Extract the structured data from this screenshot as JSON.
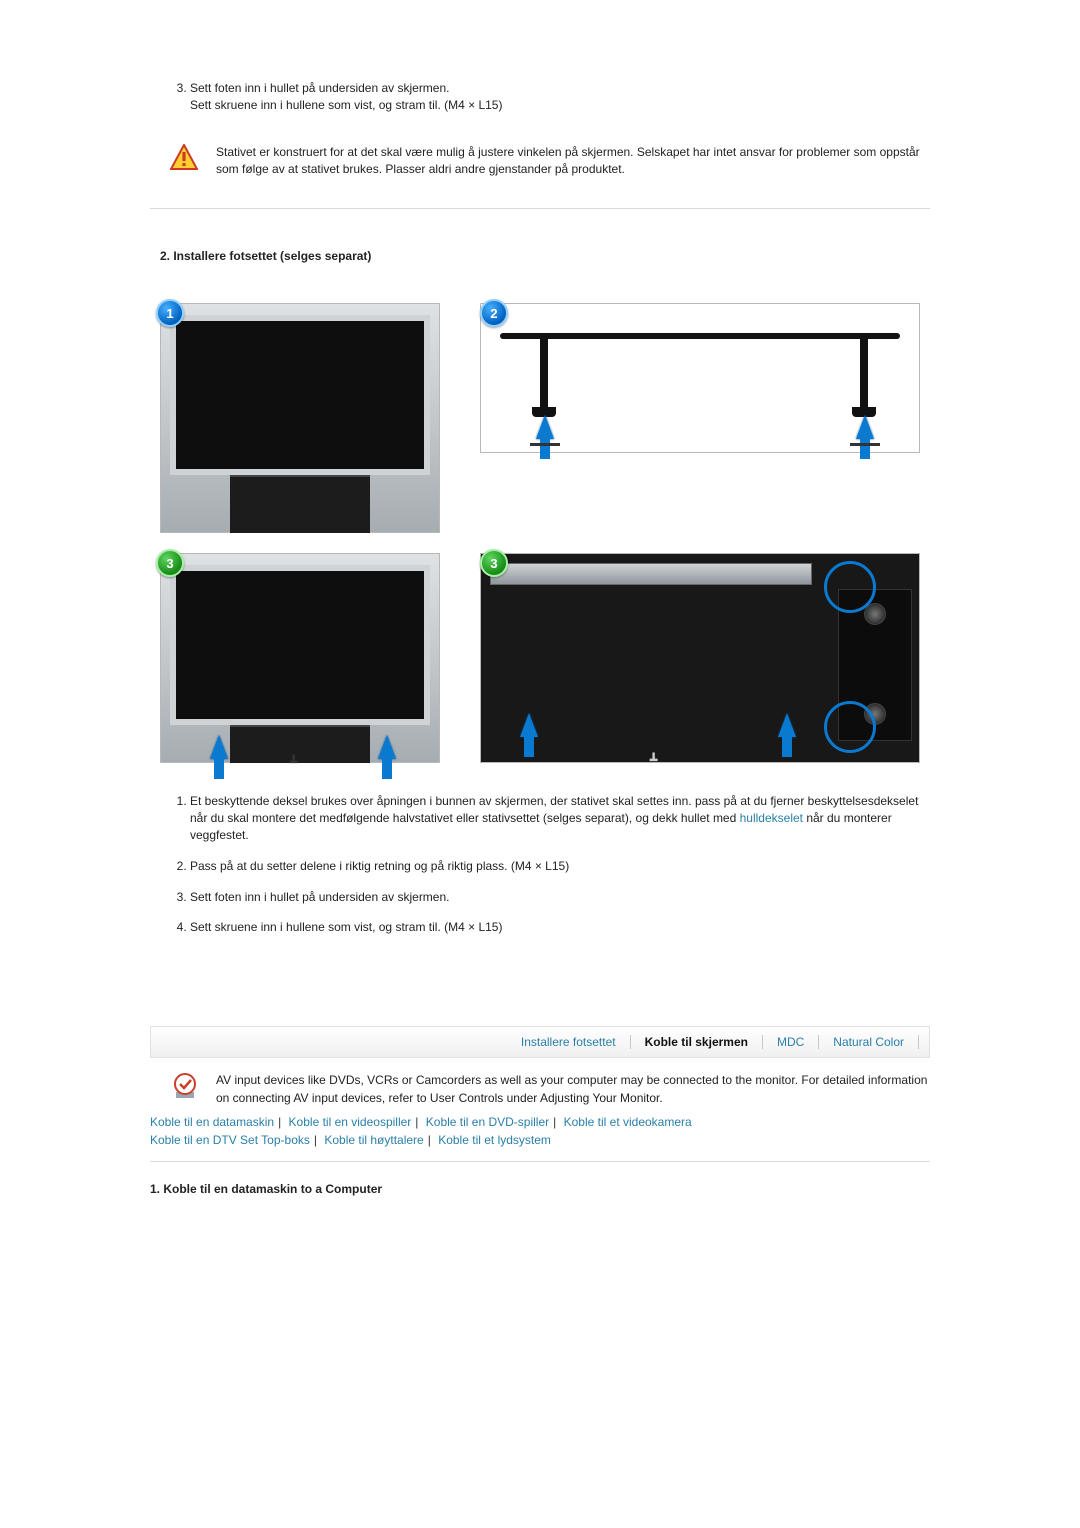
{
  "topList": {
    "start": 3,
    "items": [
      "Sett foten inn i hullet på undersiden av skjermen.\nSett skruene inn i hullene som vist, og stram til. (M4 × L15)"
    ]
  },
  "warning": {
    "text": "Stativet er konstruert for at det skal være mulig å justere vinkelen på skjermen. Selskapet har intet ansvar for problemer som oppstår som følge av at stativet brukes. Plasser aldri andre gjenstander på produktet."
  },
  "sectionTitle": "2. Installere fotsettet (selges separat)",
  "badges": {
    "b1": "1",
    "b2": "2",
    "b3a": "3",
    "b3b": "3"
  },
  "lowList": {
    "item1_pre": "Et beskyttende deksel brukes over åpningen i bunnen av skjermen, der stativet skal settes inn. pass på at du fjerner beskyttelsesdekselet når du skal montere det medfølgende halvstativet eller stativsettet (selges separat), og dekk hullet med ",
    "item1_link": "hulldekselet",
    "item1_post": " når du monterer veggfestet.",
    "item2": "Pass på at du setter delene i riktig retning og på riktig plass. (M4 × L15)",
    "item3": "Sett foten inn i hullet på undersiden av skjermen.",
    "item4": "Sett skruene inn i hullene som vist, og stram til. (M4 × L15)"
  },
  "tabs": {
    "t1": "Installere fotsettet",
    "t2": "Koble til skjermen",
    "t3": "MDC",
    "t4": "Natural Color"
  },
  "footer": {
    "note": "AV input devices like DVDs, VCRs or Camcorders as well as your computer may be connected to the monitor. For detailed information on connecting AV input devices, refer to User Controls under Adjusting Your Monitor.",
    "links1": [
      "Koble til en datamaskin",
      "Koble til en videospiller",
      "Koble til en DVD-spiller",
      "Koble til et videokamera"
    ],
    "links2": [
      "Koble til en DTV Set Top-boks",
      "Koble til høyttalere",
      "Koble til et lydsystem"
    ]
  },
  "heading2": "1. Koble til en datamaskin to a Computer"
}
